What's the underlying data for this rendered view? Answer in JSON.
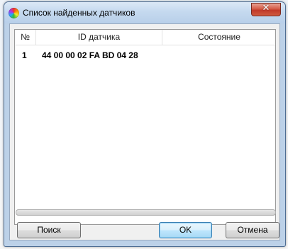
{
  "window": {
    "title": "Список найденных датчиков",
    "close_icon": "close-x-icon",
    "app_icon": "color-wheel-icon"
  },
  "table": {
    "columns": [
      "№",
      "ID датчика",
      "Состояние"
    ],
    "rows": [
      {
        "num": "1",
        "id": "44 00 00 02 FA BD 04 28",
        "state": ""
      }
    ]
  },
  "buttons": {
    "search_label": "Поиск",
    "ok_label": "OK",
    "cancel_label": "Отмена"
  }
}
